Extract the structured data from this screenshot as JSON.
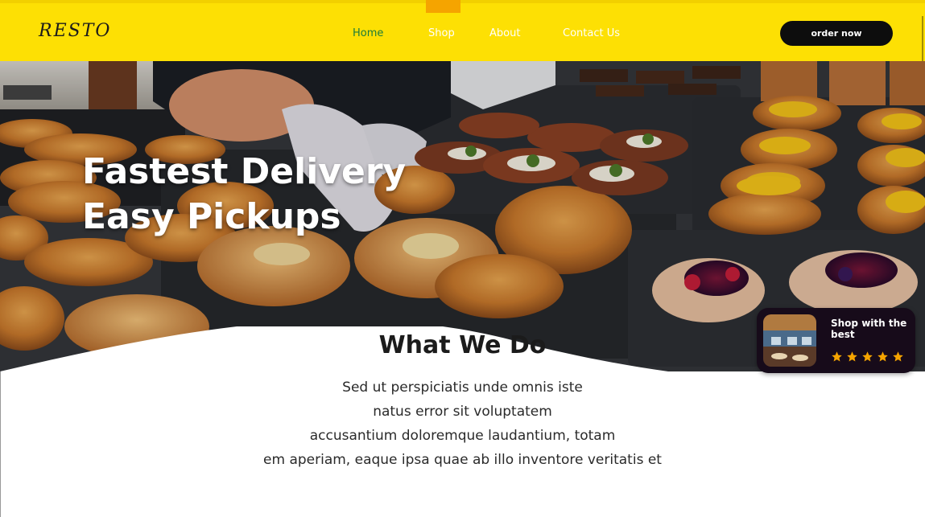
{
  "header": {
    "logo": "RESTO",
    "nav": [
      {
        "label": "Home"
      },
      {
        "label": "Shop"
      },
      {
        "label": "About"
      },
      {
        "label": "Contact Us"
      }
    ],
    "order_label": "order now",
    "colors": {
      "bar": "#fde004",
      "active_link": "#1b7b3a",
      "indicator": "#f5a400"
    }
  },
  "hero": {
    "line1": "Fastest Delivery",
    "line2": "Easy Pickups"
  },
  "section": {
    "title": "What We Do",
    "lines": [
      "Sed ut perspiciatis unde omnis iste",
      "natus error sit voluptatem",
      "accusantium doloremque laudantium, totam",
      "em aperiam, eaque ipsa quae ab illo inventore veritatis et"
    ]
  },
  "promo": {
    "text": "Shop with the best",
    "rating": 5,
    "star_icon": "star-icon"
  }
}
